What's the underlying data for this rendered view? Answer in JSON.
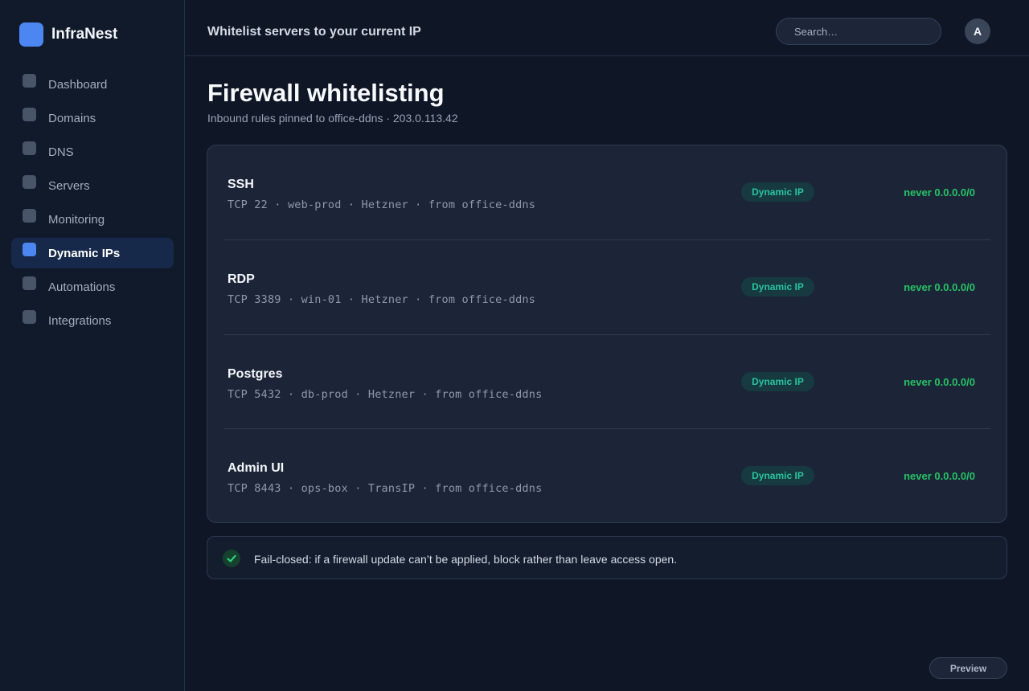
{
  "brand": {
    "name": "InfraNest",
    "logo_color": "#4c86f0"
  },
  "sidebar": {
    "items": [
      {
        "label": "Dashboard",
        "active": false
      },
      {
        "label": "Domains",
        "active": false
      },
      {
        "label": "DNS",
        "active": false
      },
      {
        "label": "Servers",
        "active": false
      },
      {
        "label": "Monitoring",
        "active": false
      },
      {
        "label": "Dynamic IPs",
        "active": true
      },
      {
        "label": "Automations",
        "active": false
      },
      {
        "label": "Integrations",
        "active": false
      }
    ]
  },
  "header": {
    "title": "Whitelist servers to your current IP",
    "search_placeholder": "Search…",
    "avatar_initial": "A"
  },
  "main": {
    "title": "Firewall whitelisting",
    "subtitle": "Inbound rules pinned to office-ddns · 203.0.113.42",
    "rules": [
      {
        "name": "SSH",
        "meta": "TCP 22 · web-prod · Hetzner · from office-ddns",
        "badge": "Dynamic IP",
        "status": "never 0.0.0.0/0"
      },
      {
        "name": "RDP",
        "meta": "TCP 3389 · win-01 · Hetzner · from office-ddns",
        "badge": "Dynamic IP",
        "status": "never 0.0.0.0/0"
      },
      {
        "name": "Postgres",
        "meta": "TCP 5432 · db-prod · Hetzner · from office-ddns",
        "badge": "Dynamic IP",
        "status": "never 0.0.0.0/0"
      },
      {
        "name": "Admin UI",
        "meta": "TCP 8443 · ops-box · TransIP · from office-ddns",
        "badge": "Dynamic IP",
        "status": "never 0.0.0.0/0"
      }
    ],
    "fail_closed": "Fail-closed: if a firewall update can’t be applied, block rather than leave access open."
  },
  "footer": {
    "preview_label": "Preview"
  },
  "colors": {
    "accent": "#4c86f0",
    "badge_text": "#2bc3a0",
    "status_ok": "#27c265"
  }
}
